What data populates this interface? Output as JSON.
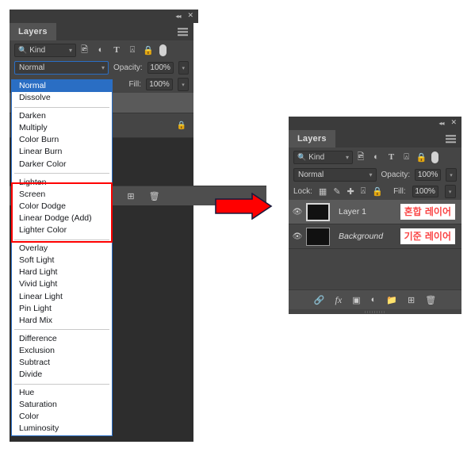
{
  "app": "Adobe Photoshop",
  "left_panel": {
    "titlebar": {
      "collapse_icon": "double-chevron-left-icon",
      "close_icon": "close-icon"
    },
    "tab_label": "Layers",
    "menu_icon": "panel-menu-icon",
    "filter": {
      "search_icon": "search-icon",
      "kind_label": "Kind",
      "caret_icon": "chevron-down-icon",
      "icons": [
        "pixel-filter-icon",
        "adjustment-filter-icon",
        "type-filter-icon",
        "shape-filter-icon",
        "smart-object-filter-icon"
      ],
      "toggle_icon": "filter-toggle-icon"
    },
    "blend": {
      "mode": "Normal",
      "caret_icon": "chevron-down-icon",
      "opacity_label": "Opacity:",
      "opacity_value": "100%",
      "opacity_stepper_icon": "chevron-down-icon",
      "fill_label": "Fill:",
      "fill_value": "100%",
      "fill_stepper_icon": "chevron-down-icon"
    },
    "hidden_layers": {
      "lock_icon": "lock-icon"
    },
    "bottom_icons": [
      "adjustment-layer-icon",
      "new-group-icon",
      "new-layer-icon",
      "delete-layer-icon"
    ]
  },
  "dropdown": {
    "groups": [
      {
        "items": [
          "Normal",
          "Dissolve"
        ],
        "selected": "Normal"
      },
      {
        "items": [
          "Darken",
          "Multiply",
          "Color Burn",
          "Linear Burn",
          "Darker Color"
        ]
      },
      {
        "items": [
          "Lighten",
          "Screen",
          "Color Dodge",
          "Linear Dodge (Add)",
          "Lighter Color"
        ],
        "highlighted": true
      },
      {
        "items": [
          "Overlay",
          "Soft Light",
          "Hard Light",
          "Vivid Light",
          "Linear Light",
          "Pin Light",
          "Hard Mix"
        ]
      },
      {
        "items": [
          "Difference",
          "Exclusion",
          "Subtract",
          "Divide"
        ]
      },
      {
        "items": [
          "Hue",
          "Saturation",
          "Color",
          "Luminosity"
        ]
      }
    ],
    "highlight_color": "#ff0000",
    "selection_color": "#2a6ec4"
  },
  "arrow": {
    "name": "flow-arrow",
    "color": "#ff0000",
    "outline": "#1a1a3c"
  },
  "right_panel": {
    "titlebar": {
      "collapse_icon": "double-chevron-left-icon",
      "close_icon": "close-icon"
    },
    "tab_label": "Layers",
    "menu_icon": "panel-menu-icon",
    "filter": {
      "search_icon": "search-icon",
      "kind_label": "Kind",
      "caret_icon": "chevron-down-icon",
      "icons": [
        "pixel-filter-icon",
        "adjustment-filter-icon",
        "type-filter-icon",
        "shape-filter-icon",
        "smart-object-filter-icon"
      ],
      "toggle_icon": "filter-toggle-icon"
    },
    "blend": {
      "mode": "Normal",
      "caret_icon": "chevron-down-icon",
      "opacity_label": "Opacity:",
      "opacity_value": "100%",
      "opacity_stepper_icon": "chevron-down-icon"
    },
    "lock": {
      "label": "Lock:",
      "icons": [
        "lock-transparency-icon",
        "lock-image-icon",
        "lock-position-icon",
        "lock-artboard-icon",
        "lock-all-icon"
      ],
      "fill_label": "Fill:",
      "fill_value": "100%",
      "fill_stepper_icon": "chevron-down-icon"
    },
    "layers": [
      {
        "visibility_icon": "eye-icon",
        "thumbnail": "sparks-thumbnail",
        "name": "Layer 1",
        "italic": false,
        "selected": true,
        "annotation": "혼합 레이어"
      },
      {
        "visibility_icon": "eye-icon",
        "thumbnail": "forest-thumbnail",
        "name": "Background",
        "italic": true,
        "selected": false,
        "annotation": "기준 레이어"
      }
    ],
    "bottom_icons": [
      "link-layers-icon",
      "layer-style-fx-icon",
      "layer-mask-icon",
      "adjustment-layer-icon",
      "new-group-icon",
      "new-layer-icon",
      "delete-layer-icon"
    ]
  },
  "colors": {
    "panel_bg": "#454545",
    "panel_header": "#3b3b3b",
    "tab_active": "#535353",
    "row_selected": "#5a5a5a",
    "strip_bg": "#4e4e4e",
    "annotation_text": "#fa4646",
    "annotation_bg": "#ffffff",
    "canvas_bg": "#2d2d2d"
  }
}
